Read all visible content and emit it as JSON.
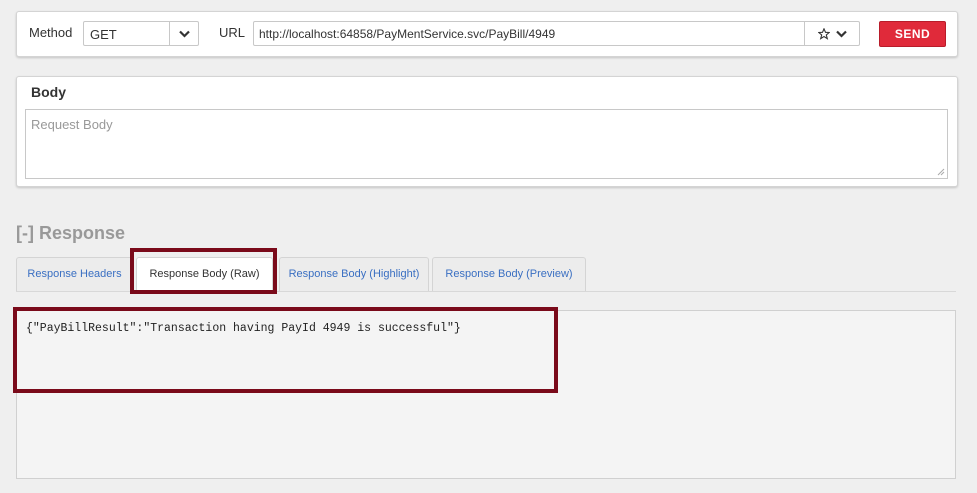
{
  "request": {
    "method_label": "Method",
    "method_value": "GET",
    "url_label": "URL",
    "url_value": "http://localhost:64858/PayMentService.svc/PayBill/4949",
    "send_label": "SEND"
  },
  "body": {
    "title": "Body",
    "placeholder": "Request Body"
  },
  "response": {
    "heading": "[-] Response",
    "tabs": [
      {
        "label": "Response Headers",
        "active": false
      },
      {
        "label": "Response Body (Raw)",
        "active": true
      },
      {
        "label": "Response Body (Highlight)",
        "active": false
      },
      {
        "label": "Response Body (Preview)",
        "active": false
      }
    ],
    "raw_body": "{\"PayBillResult\":\"Transaction having PayId 4949 is successful\"}"
  },
  "colors": {
    "send_button": "#e02a3a",
    "highlight_box": "#7a0a1a",
    "tab_link": "#3a6fc2"
  },
  "icons": [
    "chevron-down-icon",
    "star-icon",
    "resize-grip-icon"
  ]
}
